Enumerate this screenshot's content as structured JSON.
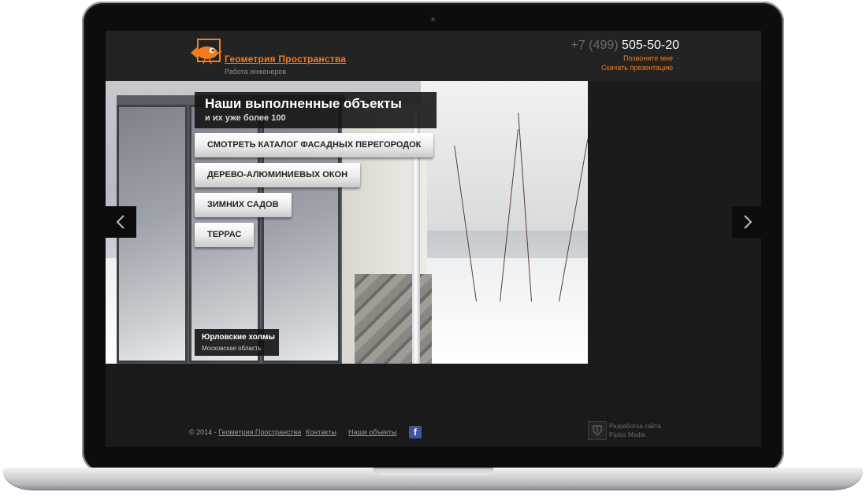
{
  "site": {
    "logo_name": "Геометрия Пространства",
    "logo_tagline": "Работа инженеров",
    "phone_code": "+7 (499)",
    "phone_number": "505-50-20",
    "links": {
      "call_me": "Позвоните мне",
      "download_presentation": "Скачать презентацию",
      "link_dot": "·"
    }
  },
  "slider": {
    "title": "Наши выполненные объекты",
    "subtitle": "и их уже более 100",
    "buttons": [
      "СМОТРЕТЬ КАТАЛОГ ФАСАДНЫХ ПЕРЕГОРОДОК",
      "ДЕРЕВО-АЛЮМИНИЕВЫХ ОКОН",
      "ЗИМНИХ САДОВ",
      "ТЕРРАС"
    ],
    "caption_title": "Юрловские холмы",
    "caption_region": "Московская область",
    "prev_icon": "chevron-left-icon",
    "next_icon": "chevron-right-icon"
  },
  "footer": {
    "copyright_prefix": "© 2014 -",
    "copyright_link": "Геометрия Пространства",
    "contacts": "Контакты",
    "our_objects": "Наши объекты",
    "facebook_glyph": "f",
    "developer_line1": "Разработка сайта",
    "developer_line2": "Piplos Media"
  },
  "colors": {
    "accent": "#f47b20",
    "page_bg": "#1a1a1b",
    "header_bg": "#232323",
    "facebook": "#3b5998"
  }
}
